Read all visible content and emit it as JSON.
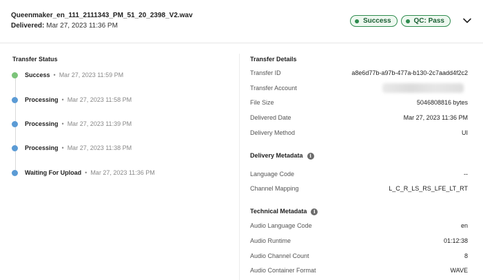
{
  "header": {
    "file_name": "Queenmaker_en_111_2111343_PM_51_20_2398_V2.wav",
    "delivered_label": "Delivered:",
    "delivered_value": "Mar 27, 2023 11:36 PM",
    "badges": [
      {
        "label": "Success"
      },
      {
        "label": "QC: Pass"
      }
    ],
    "chevron_icon": "chevron-down-icon"
  },
  "transfer_status": {
    "title": "Transfer Status",
    "items": [
      {
        "status": "Success",
        "separator": "•",
        "time": "Mar 27, 2023 11:59 PM",
        "color": "#7cc47a"
      },
      {
        "status": "Processing",
        "separator": "•",
        "time": "Mar 27, 2023 11:58 PM",
        "color": "#5b9bd5"
      },
      {
        "status": "Processing",
        "separator": "•",
        "time": "Mar 27, 2023 11:39 PM",
        "color": "#5b9bd5"
      },
      {
        "status": "Processing",
        "separator": "•",
        "time": "Mar 27, 2023 11:38 PM",
        "color": "#5b9bd5"
      },
      {
        "status": "Waiting For Upload",
        "separator": "•",
        "time": "Mar 27, 2023 11:36 PM",
        "color": "#5b9bd5"
      }
    ]
  },
  "transfer_details": {
    "title": "Transfer Details",
    "rows": [
      {
        "key": "Transfer ID",
        "value": "a8e6d77b-a97b-477a-b130-2c7aadd4f2c2"
      },
      {
        "key": "Transfer Account",
        "value": ""
      },
      {
        "key": "File Size",
        "value": "5046808816 bytes"
      },
      {
        "key": "Delivered Date",
        "value": "Mar 27, 2023 11:36 PM"
      },
      {
        "key": "Delivery Method",
        "value": "UI"
      }
    ]
  },
  "delivery_metadata": {
    "title": "Delivery Metadata",
    "rows": [
      {
        "key": "Language Code",
        "value": "--"
      },
      {
        "key": "Channel Mapping",
        "value": "L_C_R_LS_RS_LFE_LT_RT"
      }
    ]
  },
  "technical_metadata": {
    "title": "Technical Metadata",
    "rows": [
      {
        "key": "Audio Language Code",
        "value": "en"
      },
      {
        "key": "Audio Runtime",
        "value": "01:12:38"
      },
      {
        "key": "Audio Channel Count",
        "value": "8"
      },
      {
        "key": "Audio Container Format",
        "value": "WAVE"
      }
    ]
  },
  "colors": {
    "success_accent": "#2e8b4e",
    "badge_bg": "#eef8f0",
    "timeline_success": "#7cc47a",
    "timeline_processing": "#5b9bd5"
  }
}
